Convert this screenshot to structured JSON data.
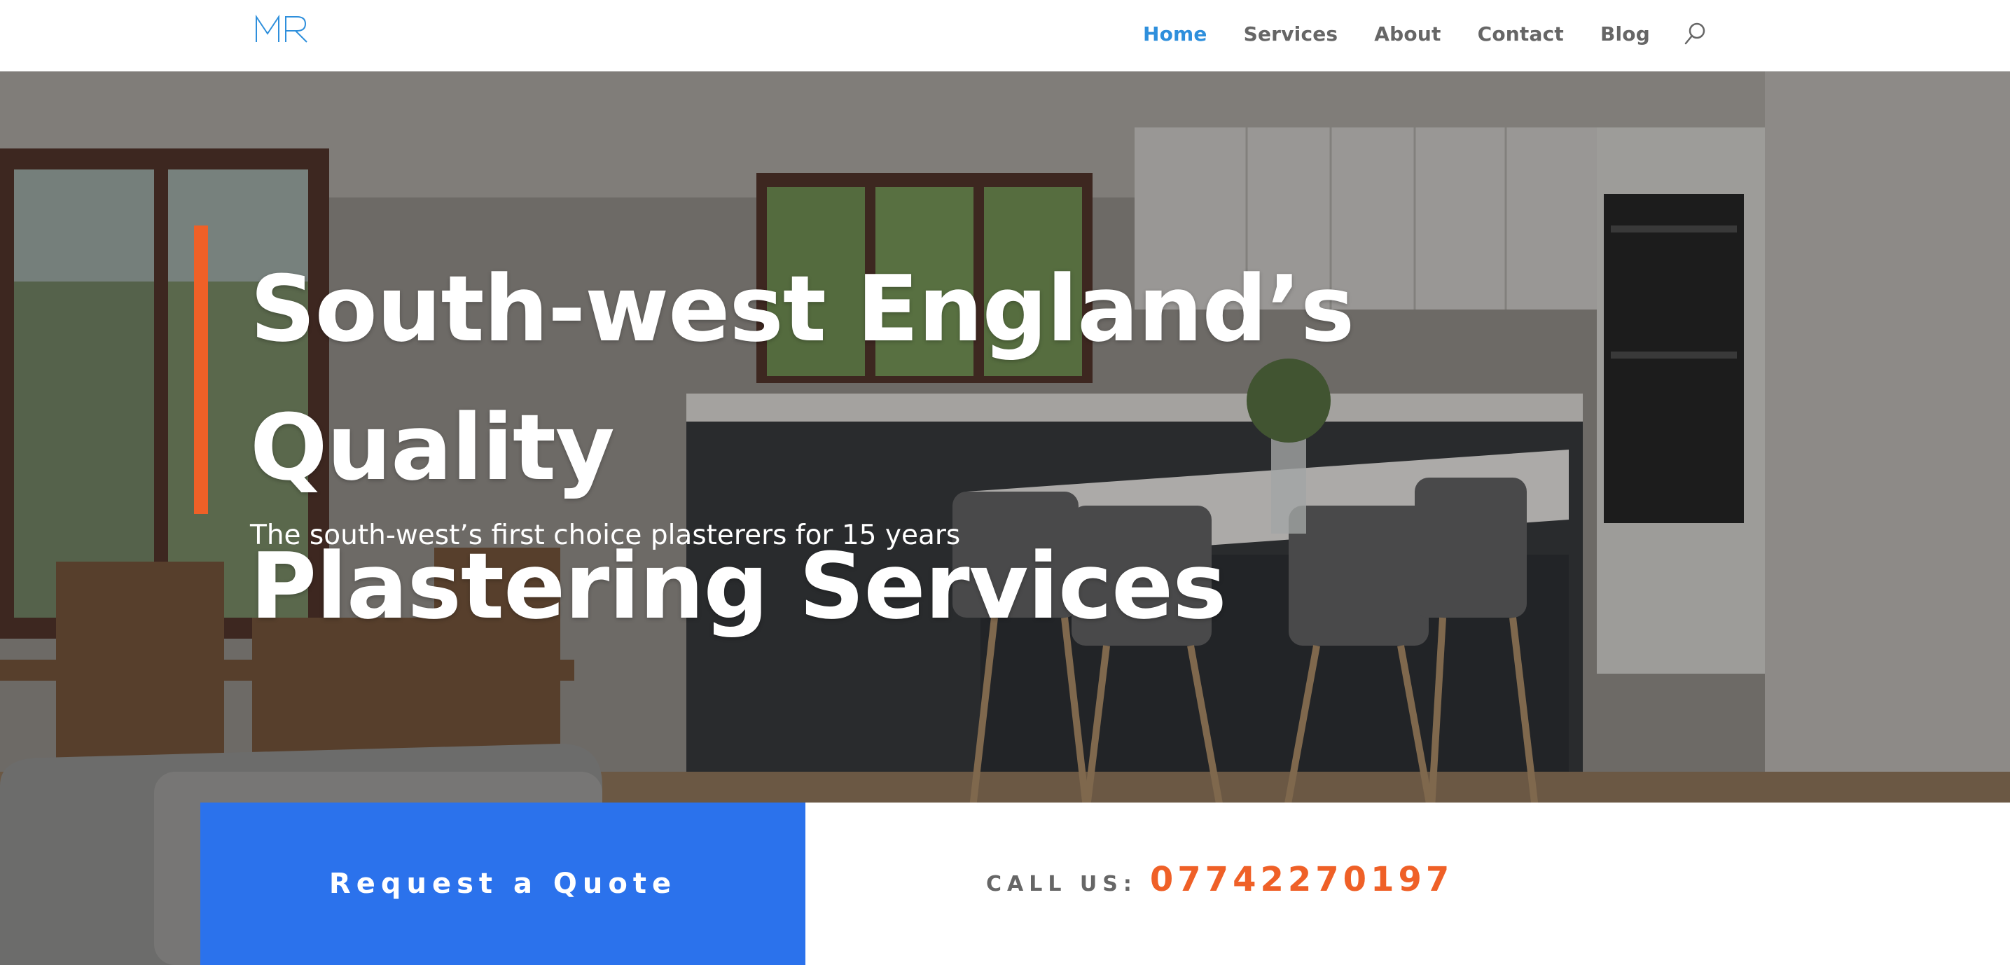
{
  "header": {
    "logo_text": "MR",
    "nav": [
      {
        "label": "Home",
        "active": true
      },
      {
        "label": "Services",
        "active": false
      },
      {
        "label": "About",
        "active": false
      },
      {
        "label": "Contact",
        "active": false
      },
      {
        "label": "Blog",
        "active": false
      }
    ],
    "search_icon": "search-icon"
  },
  "hero": {
    "title_line1": "South-west England’s Quality",
    "title_line2": "Plastering Services",
    "subtitle": "The south-west’s first choice plasterers for 15 years",
    "background": "kitchen-interior-photo"
  },
  "cta": {
    "quote_label": "Request a Quote",
    "call_label": "CALL US:",
    "phone": "07742270197"
  },
  "colors": {
    "accent_orange": "#ef6027",
    "button_blue": "#2b72ec",
    "nav_active": "#2e8fdc",
    "nav_text": "#666666"
  }
}
